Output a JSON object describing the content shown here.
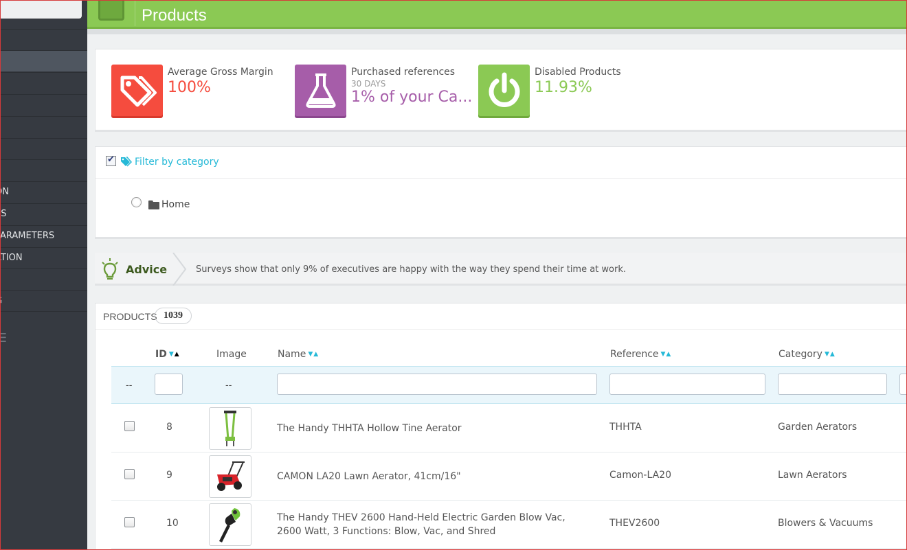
{
  "sidebar": {
    "items": [
      {
        "label": "",
        "active": false
      },
      {
        "label": "",
        "active": true
      },
      {
        "label": "",
        "active": false
      },
      {
        "label": "",
        "active": false
      },
      {
        "label": "",
        "active": false
      },
      {
        "label": "",
        "active": false
      },
      {
        "label": "",
        "active": false
      },
      {
        "label": "ON",
        "active": false
      },
      {
        "label": "ES",
        "active": false
      },
      {
        "label": "PARAMETERS",
        "active": false
      },
      {
        "label": "ATION",
        "active": false
      },
      {
        "label": "",
        "active": false
      },
      {
        "label": "G",
        "active": false
      }
    ]
  },
  "header": {
    "title": "Products",
    "accent": "#8bc954"
  },
  "kpis": [
    {
      "label": "Average Gross Margin",
      "sub": "",
      "value": "100%",
      "color": "#f54c3e",
      "icon": "tags-icon"
    },
    {
      "label": "Purchased references",
      "sub": "30 DAYS",
      "value": "1% of your Ca...",
      "color": "#a65da9",
      "icon": "flask-icon"
    },
    {
      "label": "Disabled Products",
      "sub": "",
      "value": "11.93%",
      "color": "#8bc954",
      "icon": "power-icon"
    }
  ],
  "filter": {
    "title": "Filter by category",
    "tree_root": "Home"
  },
  "advice": {
    "title": "Advice",
    "text": "Surveys show that only 9% of executives are happy with the way they spend their time at work."
  },
  "products": {
    "title": "PRODUCTS",
    "count": "1039",
    "columns": {
      "id": "ID",
      "image": "Image",
      "name": "Name",
      "reference": "Reference",
      "category": "Category"
    },
    "filter_row": {
      "bulk_dash": "--",
      "image_dash": "--"
    },
    "rows": [
      {
        "id": "8",
        "name": "The Handy THHTA Hollow Tine Aerator",
        "reference": "THHTA",
        "category": "Garden Aerators",
        "image": "aerator-icon"
      },
      {
        "id": "9",
        "name": "CAMON LA20 Lawn Aerator, 41cm/16\"",
        "reference": "Camon-LA20",
        "category": "Lawn Aerators",
        "image": "lawn-aerator-icon"
      },
      {
        "id": "10",
        "name": "The Handy THEV 2600 Hand-Held Electric Garden Blow Vac, 2600 Watt, 3 Functions: Blow, Vac, and Shred",
        "reference": "THEV2600",
        "category": "Blowers & Vacuums",
        "image": "blower-icon"
      }
    ]
  }
}
